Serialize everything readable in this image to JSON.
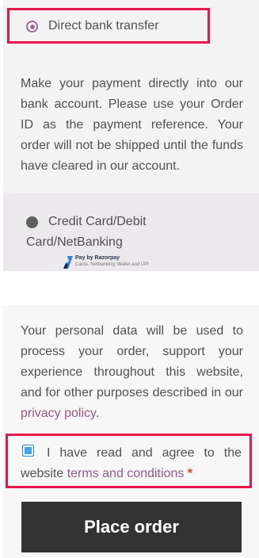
{
  "payment_methods": {
    "bank_transfer": {
      "label": "Direct bank transfer",
      "description": "Make your payment directly into our bank account. Please use your Order ID as the payment reference. Your order will not be shipped until the funds have cleared in our account."
    },
    "razorpay": {
      "label_line1": "Credit Card/Debit",
      "label_line2": "Card/NetBanking",
      "logo_title": "Pay by Razorpay",
      "logo_subtitle": "Cards, Netbanking, Wallet and UPI"
    }
  },
  "privacy": {
    "text": "Your personal data will be used to process your order, support your experience throughout this website, and for other purposes described in our",
    "link": "privacy policy",
    "period": "."
  },
  "terms": {
    "text": "I have read and agree to the website",
    "link": "terms and conditions",
    "required_marker": "*"
  },
  "place_order": {
    "label": "Place order"
  },
  "colors": {
    "highlight": "#e8164f",
    "link": "#96588a",
    "button_bg": "#333333"
  }
}
